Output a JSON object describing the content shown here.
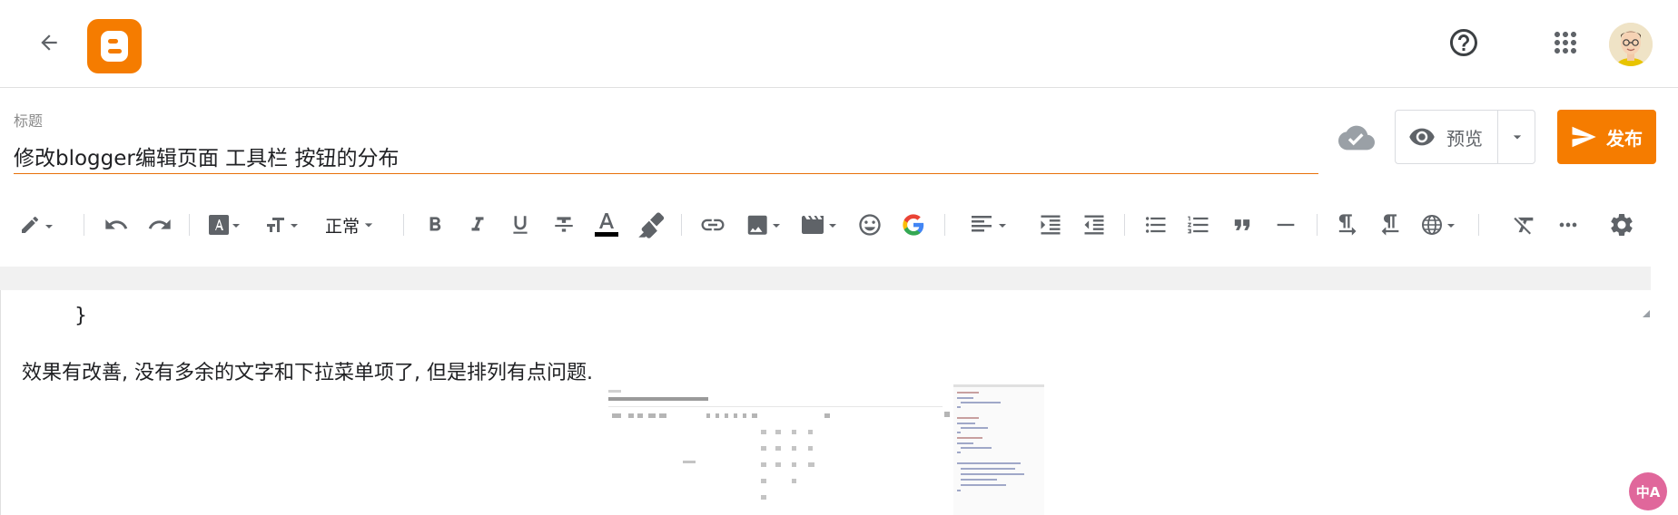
{
  "header": {
    "back_icon": "arrow-back-icon",
    "logo": "blogger-logo",
    "help_icon": "help-circle-icon",
    "apps_icon": "apps-grid-icon",
    "avatar": "user-avatar"
  },
  "post": {
    "title_label": "标题",
    "title_value": "修改blogger编辑页面 工具栏 按钮的分布",
    "save_status_icon": "cloud-saved-icon",
    "preview_label": "预览",
    "publish_label": "发布"
  },
  "toolbar": {
    "format_select": "正常",
    "icons": [
      "pencil-icon",
      "undo-icon",
      "redo-icon",
      "font-icon",
      "font-size-icon",
      "bold-icon",
      "italic-icon",
      "underline-icon",
      "strikethrough-icon",
      "text-color-icon",
      "highlight-icon",
      "link-icon",
      "image-icon",
      "video-icon",
      "emoji-icon",
      "google-icon",
      "align-icon",
      "indent-icon",
      "outdent-icon",
      "bulleted-list-icon",
      "numbered-list-icon",
      "quote-icon",
      "horizontal-rule-icon",
      "ltr-icon",
      "rtl-icon",
      "language-icon",
      "clear-format-icon",
      "more-icon",
      "settings-icon"
    ],
    "colors": {
      "accent": "#f57c00",
      "icon": "#5f6368",
      "text_color_bar": "#000000"
    }
  },
  "content": {
    "brace": "}",
    "paragraph": "效果有改善, 没有多余的文字和下拉菜单项了, 但是排列有点问题.",
    "image": "editor-screenshot-thumbnail"
  },
  "translate_button": "中A"
}
